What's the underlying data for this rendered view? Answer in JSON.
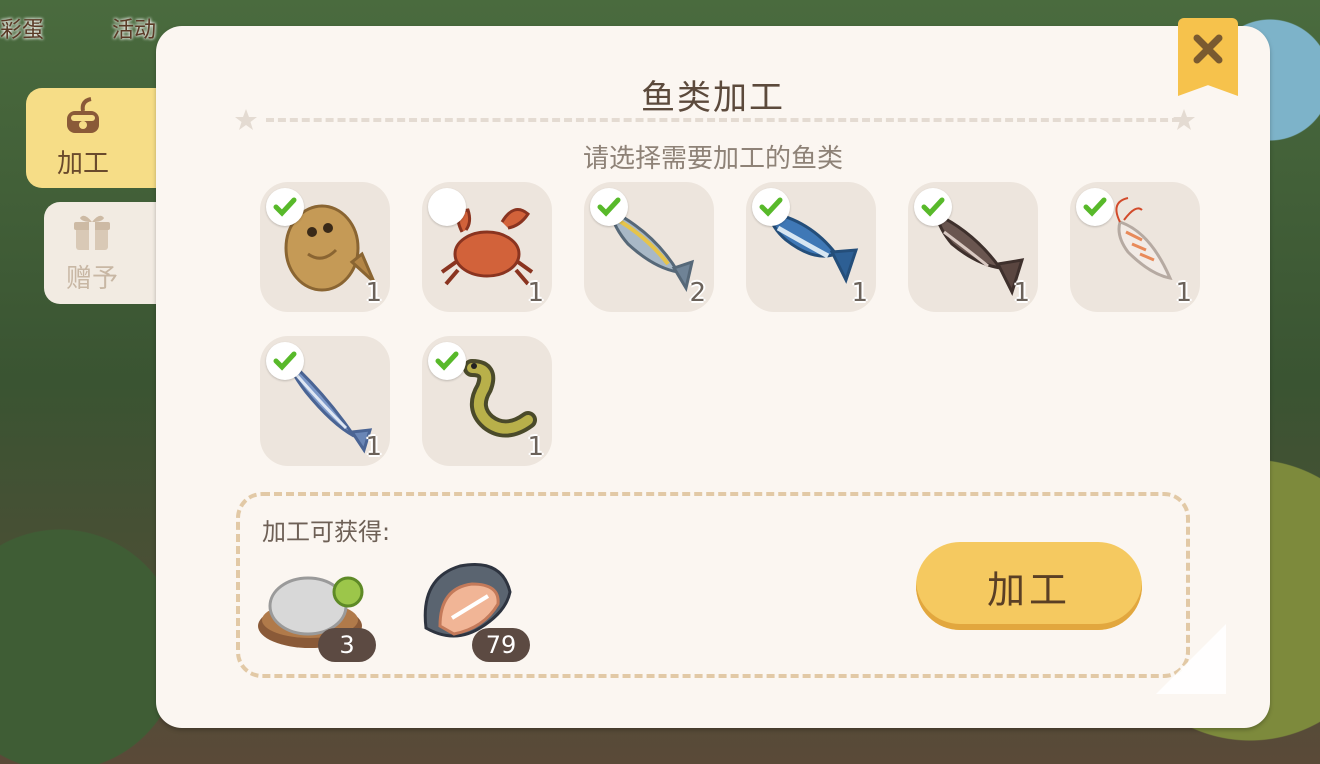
{
  "topnav": [
    "彩蛋",
    "活动"
  ],
  "side_tabs": [
    {
      "label": "加工",
      "icon": "pot-icon",
      "active": true
    },
    {
      "label": "赠予",
      "icon": "gift-icon",
      "active": false
    }
  ],
  "panel": {
    "title": "鱼类加工",
    "subtitle": "请选择需要加工的鱼类"
  },
  "fish": [
    {
      "name": "flounder",
      "count": "1",
      "selected": true
    },
    {
      "name": "crab",
      "count": "1",
      "selected": false
    },
    {
      "name": "yellowfin",
      "count": "2",
      "selected": true
    },
    {
      "name": "tuna",
      "count": "1",
      "selected": true
    },
    {
      "name": "sturgeon",
      "count": "1",
      "selected": true
    },
    {
      "name": "shrimp",
      "count": "1",
      "selected": true
    },
    {
      "name": "saury",
      "count": "1",
      "selected": true
    },
    {
      "name": "eel",
      "count": "1",
      "selected": true
    }
  ],
  "rewards": {
    "label": "加工可获得:",
    "items": [
      {
        "name": "sea-salt",
        "count": "3"
      },
      {
        "name": "fish-steak",
        "count": "79"
      }
    ]
  },
  "process_button": "加工",
  "colors": {
    "accent": "#f5c960",
    "check": "#58b92a",
    "panel": "#fbf6f1"
  }
}
